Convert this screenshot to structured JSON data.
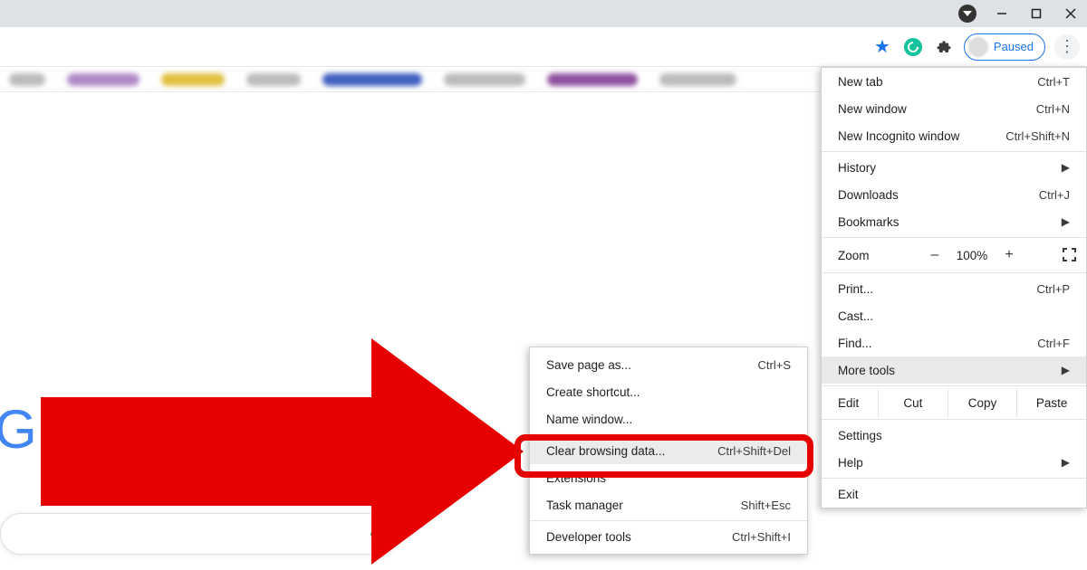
{
  "window": {
    "minimize_title": "Minimize",
    "maximize_title": "Maximize",
    "close_title": "Close"
  },
  "toolbar": {
    "profile_status": "Paused"
  },
  "menu": {
    "new_tab": {
      "label": "New tab",
      "shortcut": "Ctrl+T"
    },
    "new_window": {
      "label": "New window",
      "shortcut": "Ctrl+N"
    },
    "new_incognito": {
      "label": "New Incognito window",
      "shortcut": "Ctrl+Shift+N"
    },
    "history": {
      "label": "History"
    },
    "downloads": {
      "label": "Downloads",
      "shortcut": "Ctrl+J"
    },
    "bookmarks": {
      "label": "Bookmarks"
    },
    "zoom": {
      "label": "Zoom",
      "minus": "–",
      "pct": "100%",
      "plus": "+"
    },
    "print": {
      "label": "Print...",
      "shortcut": "Ctrl+P"
    },
    "cast": {
      "label": "Cast..."
    },
    "find": {
      "label": "Find...",
      "shortcut": "Ctrl+F"
    },
    "more_tools": {
      "label": "More tools"
    },
    "edit": {
      "label": "Edit",
      "cut": "Cut",
      "copy": "Copy",
      "paste": "Paste"
    },
    "settings": {
      "label": "Settings"
    },
    "help": {
      "label": "Help"
    },
    "exit": {
      "label": "Exit"
    }
  },
  "submenu": {
    "save_page": {
      "label": "Save page as...",
      "shortcut": "Ctrl+S"
    },
    "create_shortcut": {
      "label": "Create shortcut..."
    },
    "name_window": {
      "label": "Name window..."
    },
    "clear_browsing": {
      "label": "Clear browsing data...",
      "shortcut": "Ctrl+Shift+Del"
    },
    "extensions": {
      "label": "Extensions"
    },
    "task_manager": {
      "label": "Task manager",
      "shortcut": "Shift+Esc"
    },
    "developer_tools": {
      "label": "Developer tools",
      "shortcut": "Ctrl+Shift+I"
    }
  },
  "page": {
    "google_g": "G"
  }
}
